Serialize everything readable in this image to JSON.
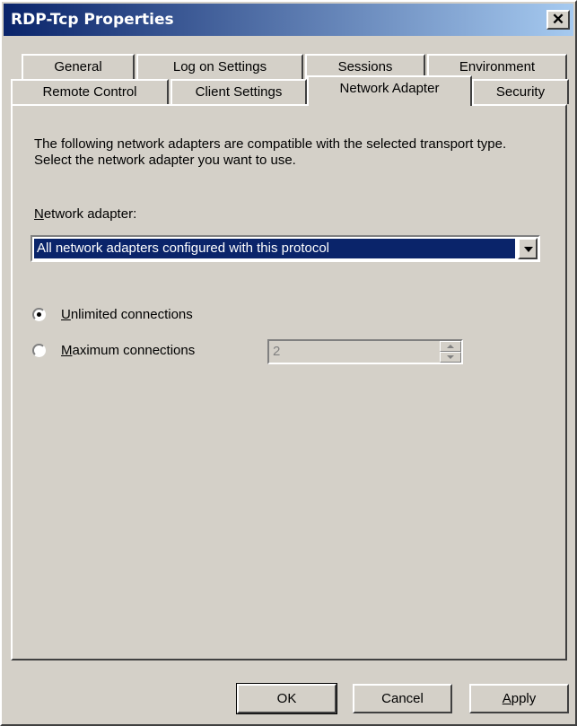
{
  "window": {
    "title": "RDP-Tcp Properties",
    "close_glyph": "✕"
  },
  "tabs_row1": [
    {
      "label": "General"
    },
    {
      "label": "Log on Settings"
    },
    {
      "label": "Sessions"
    },
    {
      "label": "Environment"
    }
  ],
  "tabs_row2": [
    {
      "label": "Remote Control"
    },
    {
      "label": "Client Settings"
    },
    {
      "label": "Network Adapter",
      "active": true
    },
    {
      "label": "Security"
    }
  ],
  "panel": {
    "description": "The following network adapters are compatible with the selected transport type. Select the network adapter you want to use.",
    "adapter_label_rest": "etwork adapter:",
    "adapter_label_key": "N",
    "adapter_value": "All network adapters configured with this protocol",
    "unlimited": {
      "key": "U",
      "rest": "nlimited connections",
      "checked": true
    },
    "maximum": {
      "key": "M",
      "rest": "aximum connections",
      "checked": false
    },
    "max_value": "2"
  },
  "buttons": {
    "ok": "OK",
    "cancel": "Cancel",
    "apply_key": "A",
    "apply_rest": "pply"
  }
}
